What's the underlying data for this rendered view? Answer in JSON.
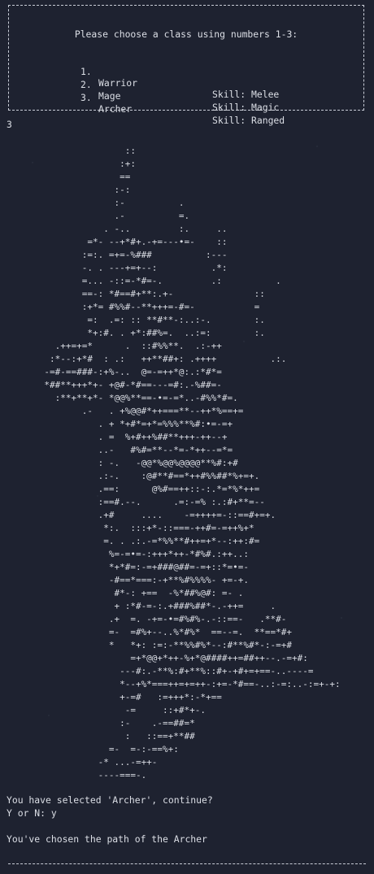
{
  "menu": {
    "title": "Please choose a class using numbers 1-3:",
    "options": [
      {
        "number": "1.",
        "name": "Warrior",
        "skill": "Skill: Melee"
      },
      {
        "number": "2.",
        "name": "Mage",
        "skill": "Skill: Magic"
      },
      {
        "number": "3.",
        "name": "Archer",
        "skill": "Skill: Ranged"
      }
    ]
  },
  "user_input": "3",
  "ascii_art": "                      ::\n                     :+:\n                     ==\n                    :-:\n                    :-          .\n                    .-          =.\n                  . -..         :.     ..\n               =*- --+*#+.-+=---•=-    ::\n              :=:. =+=-%###          :---\n              -. . ---+=+--:          .*:\n              =... -::=-*#=-.         .:          .\n              ==-: *#==#+**:.+-               ::\n              :+*= #%%#--**+++=-#=-           =\n               =:  .=: :: **#**-:..:-.        :.\n               *+:#. . +*:##%=.  ..:=:        :.\n         .++=+=*      .  ::#%%**.  .:-++\n        :*--:+*#  : .:   ++**##+: .++++          .:.\n       -=#-==###-:+%-..  @=-=++*@:.:*#*=\n       *##**+++*+- +@#-*#==---=#:.-%##=-\n         :**+**+*- *@@%**==-•=-=*..-#%%*#=.\n              .-   . +%@@#*++===**--++*%==+=\n                 . + *+#*=+*=%%%**%#:•=-=+\n                 . =  %+#++%##**+++-++--+\n                 ..-   #%#=**--*=-*++--=*=\n                 : -.   -@@*%@@%@@@@**%#:+#\n                 .:-.    :@#**#==*++#%%##*%+=+.\n                 .==:      @%#==++::-:.*=*%*++=\n                 :==#.--.      .=:-=% :.:#+**=--\n                 .+#     ....    -=++++=-::==#+=+.\n                  *:.  :::+*-::===-++#=-=++%+*\n                  =. . .:.-=*%%**#++=+*--:++:#=\n                   %=-=•=-:+++*++-*#%#.:++..:\n                   *+*#=:-=+###@##=-=+::*=•=-\n                   -#==*===:-+**%#%%%%- +=-+.\n                    #*-: +==  -%*##%@#: =- .\n                    + :*#-=-:.+###%##*-.-++=     .\n                   .+  =. -+=-•=#%#%-.-::==-   .**#-\n                   =-  =#%+--..%*#%*  ==--=.  **==*#+\n                   *   *+: :=:-**%%#%*--:#**%#*-:-=+#\n                       =+*@@+*++-%+*@####++=##++--.-=+#:\n                     ---#:.-**%:#+**%::#+-+#+=+==-..----=\n                     *--+%*===++=+=++-:+=-*#==-..:-=:..-:=+-+:\n                     +-=#   :=+++*:-*+==\n                      -=     ::+#*+-.\n                     :-    .-==##=*\n                      :   ::==+**##\n                   =-  =-:-==%+:\n                 -* ...-=++-\n                 ----===-.",
  "prompt": "You have selected 'Archer', continue?",
  "confirm": "Y or N: y",
  "result": "You've chosen the path of the Archer"
}
